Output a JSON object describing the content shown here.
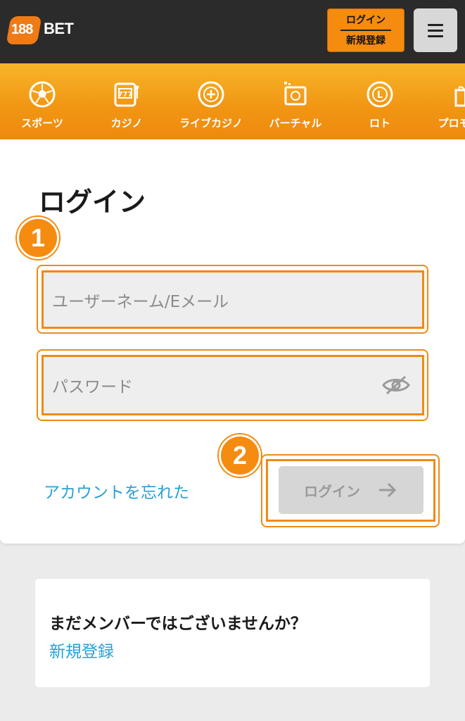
{
  "header": {
    "logo_number": "188",
    "logo_text": "BET",
    "login_label": "ログイン",
    "register_label": "新規登録",
    "menu_icon": "hamburger-icon",
    "brand_color": "#f58b0f"
  },
  "nav": {
    "items": [
      {
        "label": "スポーツ",
        "icon": "soccer-ball-icon"
      },
      {
        "label": "カジノ",
        "icon": "slot-machine-icon"
      },
      {
        "label": "ライブカジノ",
        "icon": "casino-chip-icon"
      },
      {
        "label": "バーチャル",
        "icon": "virtual-screen-icon"
      },
      {
        "label": "ロト",
        "icon": "lotto-ball-icon"
      },
      {
        "label": "プロモーシ",
        "icon": "gift-icon"
      }
    ]
  },
  "login": {
    "title": "ログイン",
    "step1": "1",
    "step2": "2",
    "username_placeholder": "ユーザーネーム/Eメール",
    "password_placeholder": "パスワード",
    "forgot_label": "アカウントを忘れた",
    "submit_label": "ログイン"
  },
  "signup": {
    "question": "まだメンバーではございませんか？",
    "link_label": "新規登録"
  },
  "colors": {
    "accent": "#f58b0f",
    "link": "#2a9fd6",
    "header_bg": "#2b2b2b"
  }
}
